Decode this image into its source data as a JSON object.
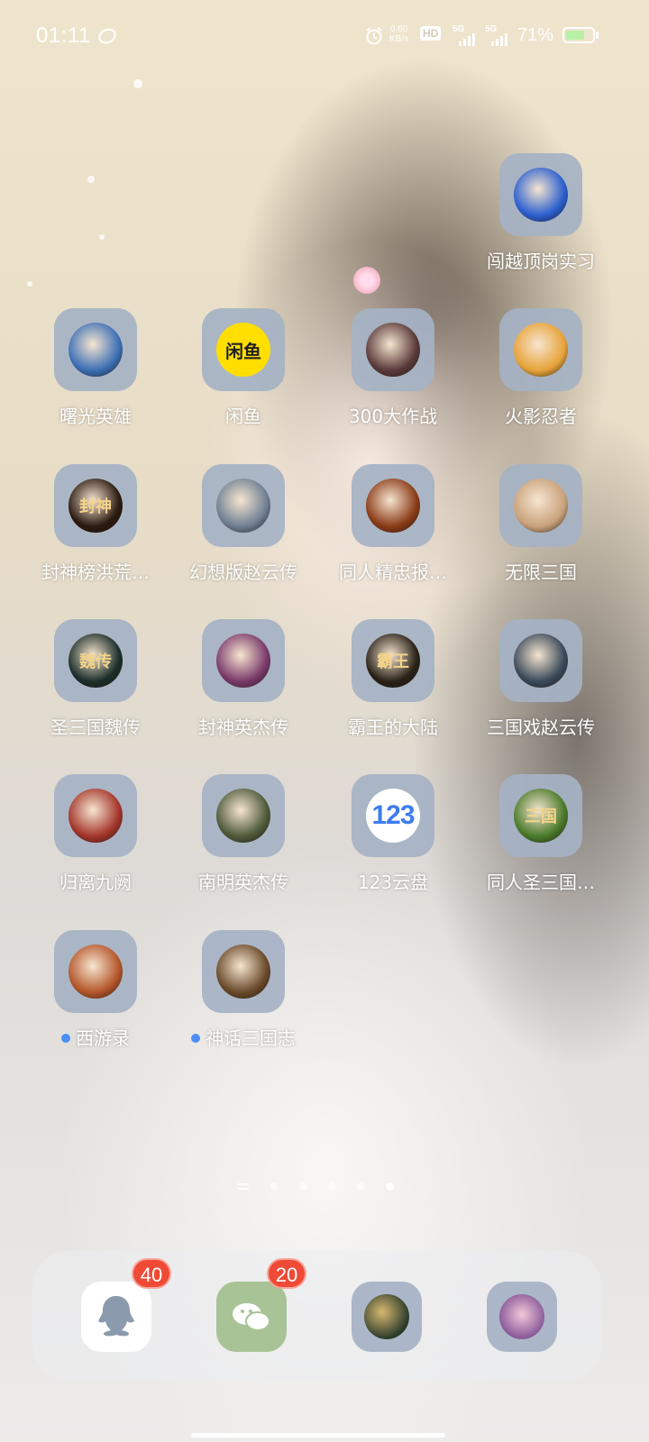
{
  "status_bar": {
    "time": "01:11",
    "net_speed_value": "0.60",
    "net_speed_unit": "KB/s",
    "hd_label": "HD",
    "sim1_label": "5G",
    "sim2_label": "5G",
    "battery_percent": "71%",
    "battery_level": 0.71
  },
  "apps": [
    {
      "label": "闯越顶岗实习",
      "icon": "gig-worker-icon",
      "color": "#2b5fcf",
      "glyph": "",
      "new": false
    },
    {
      "label": "曙光英雄",
      "icon": "hero-avatar-icon",
      "color": "#3c6fb5",
      "glyph": "",
      "new": false
    },
    {
      "label": "闲鱼",
      "icon": "xianyu-icon",
      "color": "#ffde00",
      "glyph": "闲鱼",
      "new": false
    },
    {
      "label": "300大作战",
      "icon": "battle-heroes-icon",
      "color": "#5a3a3a",
      "glyph": "",
      "new": false
    },
    {
      "label": "火影忍者",
      "icon": "ninja-icon",
      "color": "#e7a33a",
      "glyph": "",
      "new": false
    },
    {
      "label": "封神榜洪荒…",
      "icon": "fengshen-icon",
      "color": "#2b1a10",
      "glyph": "封神",
      "new": false
    },
    {
      "label": "幻想版赵云传",
      "icon": "zhaoyun-icon",
      "color": "#6f7f93",
      "glyph": "",
      "new": false
    },
    {
      "label": "同人精忠报…",
      "icon": "horseman-icon",
      "color": "#8a3b18",
      "glyph": "",
      "new": false
    },
    {
      "label": "无限三国",
      "icon": "warrior-icon",
      "color": "#c9a27c",
      "glyph": "",
      "new": false
    },
    {
      "label": "圣三国魏传",
      "icon": "wei-icon",
      "color": "#1c2f2a",
      "glyph": "魏传",
      "new": false
    },
    {
      "label": "封神英杰传",
      "icon": "heroine-icon",
      "color": "#7a3a6a",
      "glyph": "",
      "new": false
    },
    {
      "label": "霸王的大陆",
      "icon": "overlord-icon",
      "color": "#2a2218",
      "glyph": "霸王",
      "new": false
    },
    {
      "label": "三国戏赵云传",
      "icon": "general-icon",
      "color": "#3a4a5a",
      "glyph": "",
      "new": false
    },
    {
      "label": "归离九阙",
      "icon": "armored-general-icon",
      "color": "#a3352a",
      "glyph": "",
      "new": false
    },
    {
      "label": "南明英杰传",
      "icon": "scholar-icon",
      "color": "#4f5a3a",
      "glyph": "",
      "new": false
    },
    {
      "label": "123云盘",
      "icon": "cloud-disk-icon",
      "color": "#3d7cf0",
      "glyph": "123",
      "new": false
    },
    {
      "label": "同人圣三国…",
      "icon": "sanguo-icon",
      "color": "#4a7a2a",
      "glyph": "三国",
      "new": false
    },
    {
      "label": "西游录",
      "icon": "monkey-king-icon",
      "color": "#b4562a",
      "glyph": "",
      "new": true
    },
    {
      "label": "神话三国志",
      "icon": "myth-icon",
      "color": "#6a4a2a",
      "glyph": "",
      "new": true
    }
  ],
  "dock": [
    {
      "icon": "qq-icon",
      "color": "#ffffff",
      "badge": "40"
    },
    {
      "icon": "wechat-icon",
      "color": "#9fc08a",
      "badge": "20"
    },
    {
      "icon": "game-dragon-icon",
      "color": "#2a3a2a",
      "badge": ""
    },
    {
      "icon": "anime-girl-icon",
      "color": "#8a5a9a",
      "badge": ""
    }
  ],
  "pages": {
    "count": 5,
    "active": 5
  }
}
